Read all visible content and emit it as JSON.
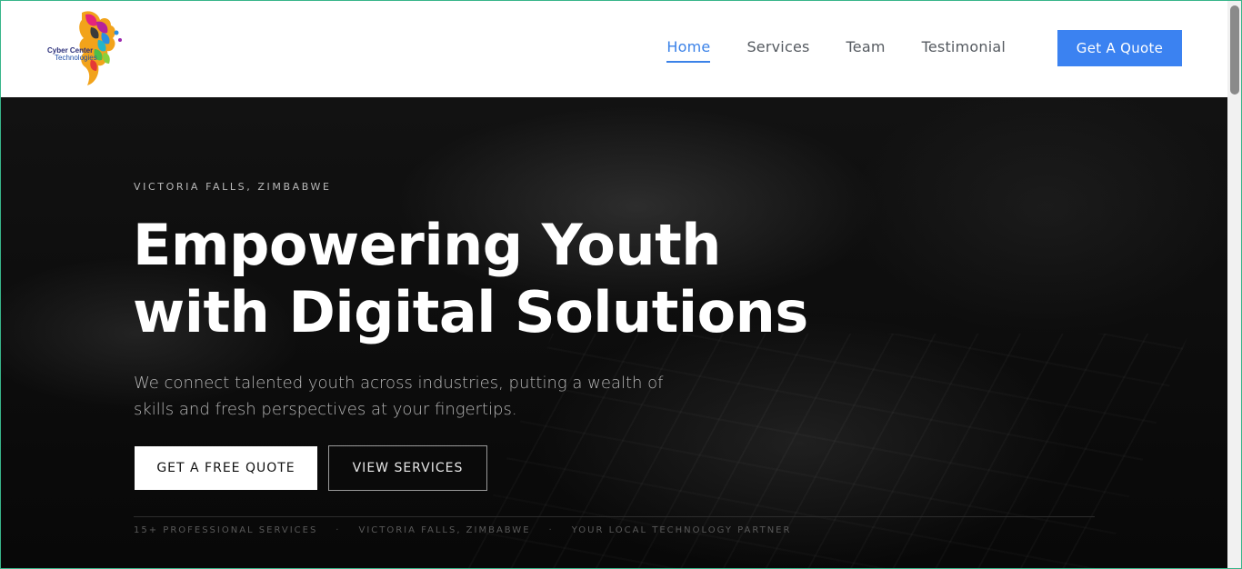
{
  "brand": {
    "logo_line1": "Cyber Center",
    "logo_line2": "Technologies"
  },
  "nav": {
    "items": [
      {
        "label": "Home",
        "active": true
      },
      {
        "label": "Services",
        "active": false
      },
      {
        "label": "Team",
        "active": false
      },
      {
        "label": "Testimonial",
        "active": false
      }
    ],
    "cta_label": "Get A Quote"
  },
  "hero": {
    "kicker": "VICTORIA FALLS, ZIMBABWE",
    "title_line1": "Empowering Youth",
    "title_line2": "with Digital Solutions",
    "subtitle_line1": "We connect talented youth across industries, putting a wealth of",
    "subtitle_line2": "skills and fresh perspectives at your fingertips.",
    "primary_button": "GET A FREE QUOTE",
    "secondary_button": "VIEW SERVICES",
    "facts": [
      "15+ PROFESSIONAL SERVICES",
      "VICTORIA FALLS, ZIMBABWE",
      "YOUR LOCAL TECHNOLOGY PARTNER"
    ],
    "fact_separator": "·"
  },
  "colors": {
    "accent": "#3b82f1",
    "hero_bg": "#0a0a0a"
  }
}
